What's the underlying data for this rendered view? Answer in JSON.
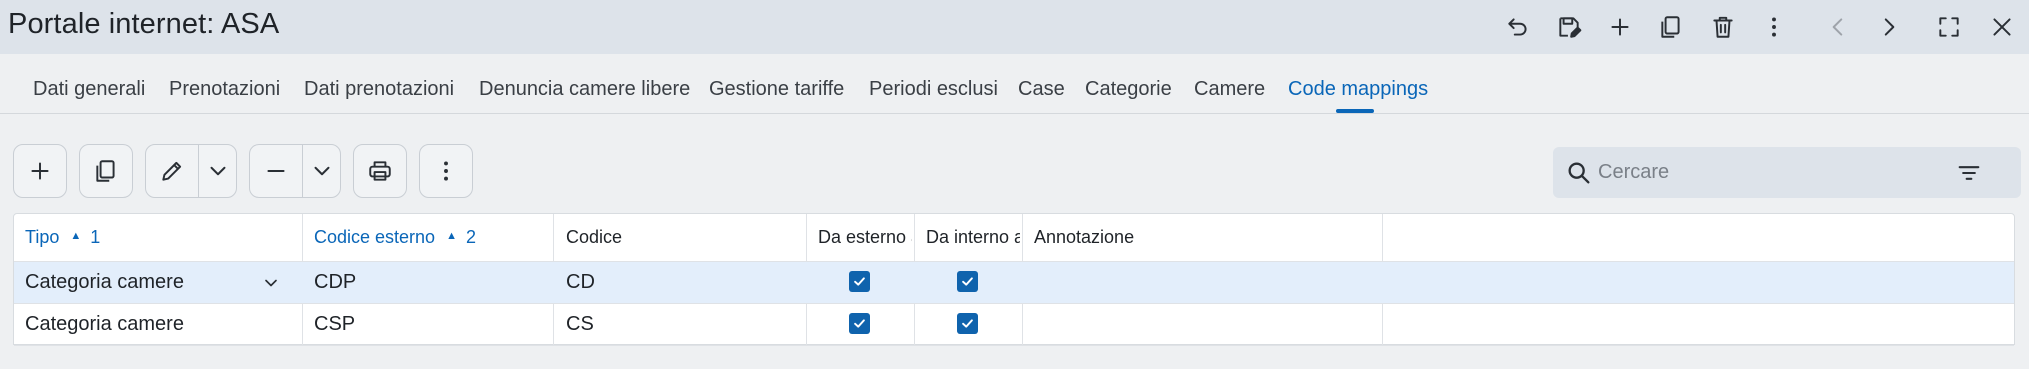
{
  "window": {
    "title": "Portale internet: ASA"
  },
  "header_icons": [
    "undo-icon",
    "save-edit-icon",
    "add-icon",
    "copy-icon",
    "delete-icon",
    "more-vertical-icon",
    "chevron-left-icon",
    "chevron-right-icon",
    "fullscreen-icon",
    "close-icon"
  ],
  "tabs": [
    {
      "label": "Dati generali"
    },
    {
      "label": "Prenotazioni"
    },
    {
      "label": "Dati prenotazioni"
    },
    {
      "label": "Denuncia camere libere"
    },
    {
      "label": "Gestione tariffe"
    },
    {
      "label": "Periodi esclusi"
    },
    {
      "label": "Case"
    },
    {
      "label": "Categorie"
    },
    {
      "label": "Camere"
    },
    {
      "label": "Code mappings",
      "active": true
    }
  ],
  "toolbar_icons": [
    "add-icon",
    "copy-icon",
    "edit-icon",
    "chevron-down-icon",
    "remove-icon",
    "chevron-down-icon",
    "print-icon",
    "more-vertical-icon"
  ],
  "search": {
    "placeholder": "Cercare",
    "value": ""
  },
  "table": {
    "columns": {
      "tipo": "Tipo",
      "tipo_sort": "1",
      "codice_esterno": "Codice esterno",
      "codice_esterno_sort": "2",
      "codice": "Codice",
      "da_esterno": "Da esterno a",
      "da_interno": "Da interno a",
      "annotazione": "Annotazione"
    },
    "rows": [
      {
        "tipo": "Categoria camere",
        "codice_esterno": "CDP",
        "codice": "CD",
        "da_esterno": true,
        "da_interno": true,
        "annotazione": ""
      },
      {
        "tipo": "Categoria camere",
        "codice_esterno": "CSP",
        "codice": "CS",
        "da_esterno": true,
        "da_interno": true,
        "annotazione": ""
      }
    ]
  },
  "colors": {
    "accent": "#0a66b8",
    "checkbox": "#0f63ad",
    "selected_row": "#e3eefb",
    "titlebar": "#dde3ea"
  }
}
